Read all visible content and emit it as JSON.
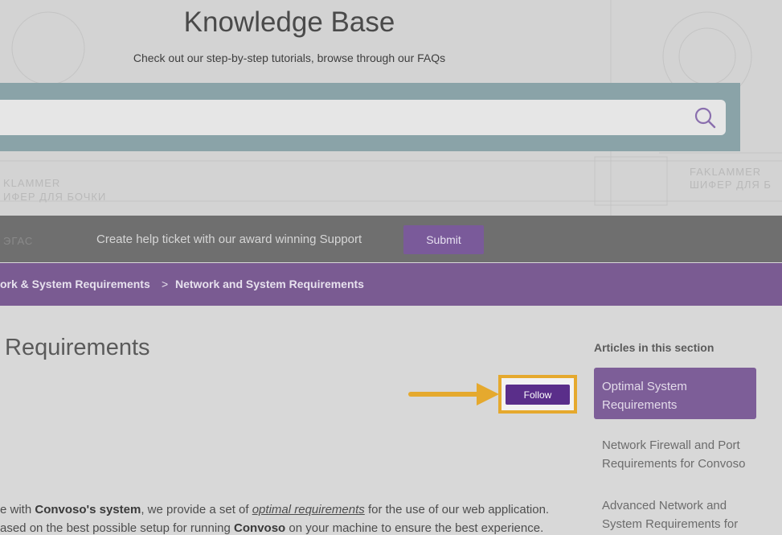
{
  "hero": {
    "title": "Knowledge Base",
    "subtitle": "Check out our step-by-step tutorials, browse through our FAQs",
    "ghost_1": "KLAMMER",
    "ghost_2": "ИФЕР ДЛЯ БОЧКИ",
    "ghost_3": "FAKLAMMER",
    "ghost_4": "ШИФЕР ДЛЯ Б",
    "ghost_5": "ЭГАС"
  },
  "search": {
    "placeholder": ""
  },
  "ticket": {
    "text": "Create help ticket with our award winning Support",
    "submit_label": "Submit"
  },
  "breadcrumb": {
    "item_1": "ork & System Requirements",
    "separator": ">",
    "item_2": "Network and System Requirements"
  },
  "article": {
    "title": "Requirements",
    "follow_label": "Follow",
    "line1_pre": "e with ",
    "line1_bold": "Convoso's system",
    "line1_mid": ", we provide a set of ",
    "line1_link": "optimal requirements",
    "line1_post": " for the use of our web application.",
    "line2_pre": "ased on the best possible setup for running ",
    "line2_bold": "Convoso",
    "line2_post": " on your machine to ensure the best experience."
  },
  "sidebar": {
    "heading": "Articles in this section",
    "items": [
      {
        "label": "Optimal System Requirements"
      },
      {
        "label": "Network Firewall and Port Requirements for Convoso"
      },
      {
        "label": "Advanced Network and System Requirements for"
      }
    ]
  },
  "colors": {
    "accent_purple": "#7a5b92",
    "follow_button": "#5a2e8a",
    "highlight_orange": "#e5a92e"
  }
}
